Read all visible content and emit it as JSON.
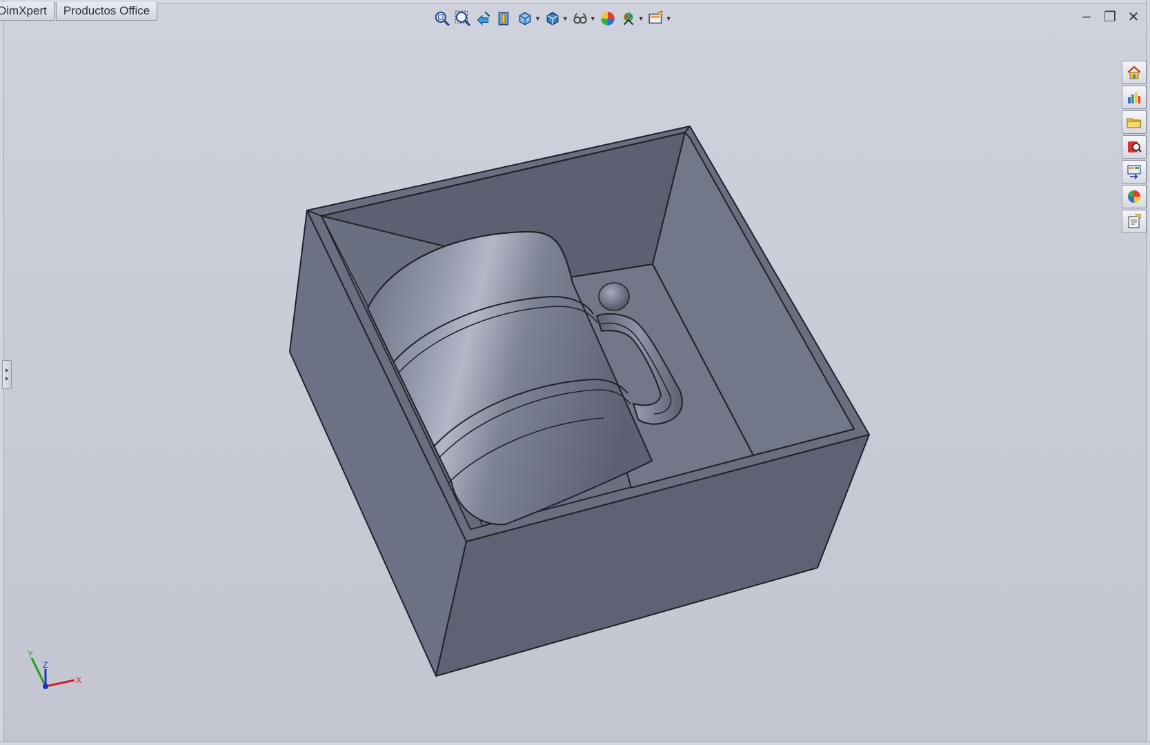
{
  "tabs": [
    {
      "label": "DimXpert"
    },
    {
      "label": "Productos Office"
    }
  ],
  "heads_up_toolbar": {
    "buttons": [
      {
        "icon": "zoom-to-fit-icon",
        "dropdown": false
      },
      {
        "icon": "zoom-to-area-icon",
        "dropdown": false
      },
      {
        "icon": "previous-view-icon",
        "dropdown": false
      },
      {
        "icon": "section-view-icon",
        "dropdown": false
      },
      {
        "icon": "view-orientation-icon",
        "dropdown": true
      },
      {
        "icon": "display-style-icon",
        "dropdown": true
      },
      {
        "icon": "hide-show-items-icon",
        "dropdown": true
      },
      {
        "icon": "edit-appearance-icon",
        "dropdown": false
      },
      {
        "icon": "apply-scene-icon",
        "dropdown": true
      },
      {
        "icon": "view-settings-icon",
        "dropdown": true
      }
    ]
  },
  "window_controls": {
    "minimize": "–",
    "restore": "❐",
    "close": "✕"
  },
  "task_pane": [
    {
      "icon": "home-icon"
    },
    {
      "icon": "design-library-icon"
    },
    {
      "icon": "file-explorer-icon"
    },
    {
      "icon": "search-icon"
    },
    {
      "icon": "view-palette-icon"
    },
    {
      "icon": "appearances-icon"
    },
    {
      "icon": "custom-properties-icon"
    }
  ],
  "triad": {
    "x_label": "X",
    "y_label": "Y",
    "z_label": "Z"
  },
  "colors": {
    "background": "#c9ccd6",
    "model_dark": "#5f6274",
    "model_mid": "#6f7386",
    "model_light": "#8a8ea1",
    "edge": "#1f2128",
    "axis_x": "#d02020",
    "axis_y": "#20a020",
    "axis_z": "#2030c0"
  }
}
